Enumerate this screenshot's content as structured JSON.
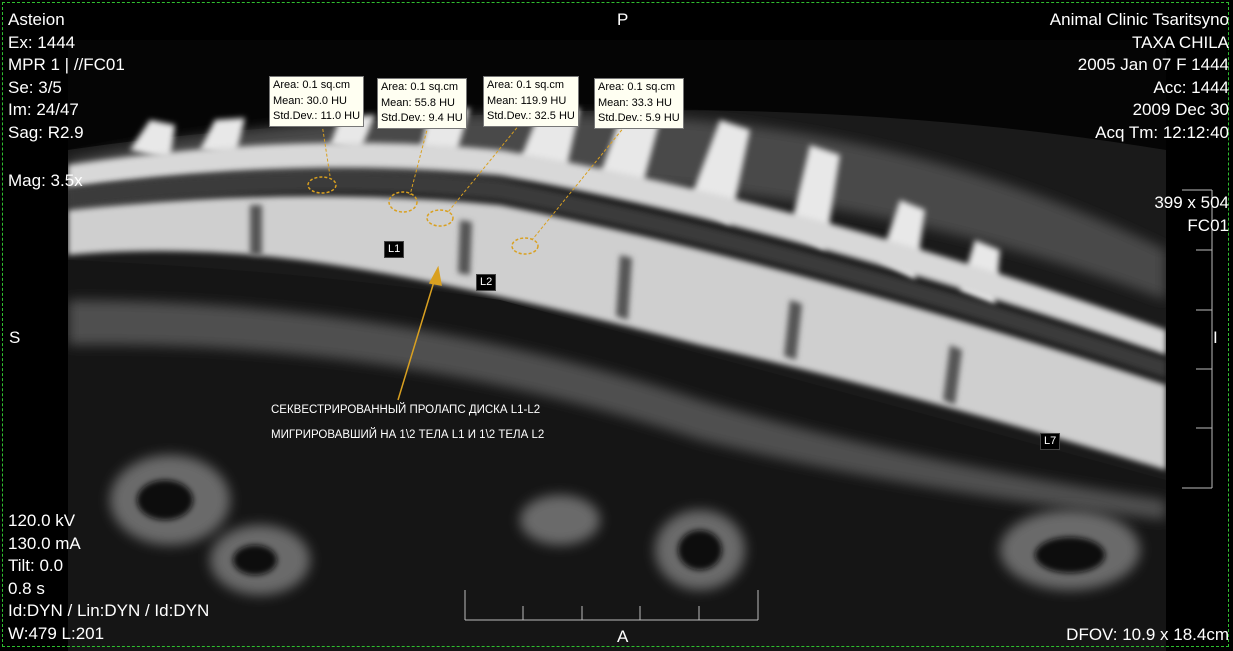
{
  "overlay": {
    "top_left": [
      "Asteion",
      "Ex: 1444",
      "MPR 1 | //FC01",
      "Se: 3/5",
      "Im: 24/47",
      "Sag: R2.9"
    ],
    "mag": "Mag: 3.5x",
    "top_center": "P",
    "top_right": [
      "Animal Clinic Tsaritsyno",
      "TAXA CHILA",
      "2005 Jan 07  F  1444",
      "Acc: 1444",
      "2009 Dec 30",
      "Acq Tm: 12:12:40"
    ],
    "matrix": [
      "399 x 504",
      "FC01"
    ],
    "left_orient": "S",
    "right_orient": "I",
    "bottom_left": [
      "120.0 kV",
      "130.0 mA",
      "Tilt: 0.0",
      "0.8 s",
      "Id:DYN / Lin:DYN / Id:DYN",
      "W:479  L:201"
    ],
    "bottom_center": "A",
    "bottom_right": "DFOV: 10.9 x 18.4cm"
  },
  "rois": [
    {
      "area": "Area: 0.1 sq.cm",
      "mean": "Mean: 30.0 HU",
      "std": "Std.Dev.: 11.0 HU"
    },
    {
      "area": "Area: 0.1 sq.cm",
      "mean": "Mean: 55.8 HU",
      "std": "Std.Dev.: 9.4 HU"
    },
    {
      "area": "Area: 0.1 sq.cm",
      "mean": "Mean: 119.9 HU",
      "std": "Std.Dev.: 32.5 HU"
    },
    {
      "area": "Area: 0.1 sq.cm",
      "mean": "Mean: 33.3 HU",
      "std": "Std.Dev.: 5.9 HU"
    }
  ],
  "vertebra_labels": {
    "l1": "L1",
    "l2": "L2",
    "l7": "L7"
  },
  "annotation": [
    "СЕКВЕСТРИРОВАННЫЙ ПРОЛАПС ДИСКА L1-L2",
    "МИГРИРОВАВШИЙ НА 1\\2 ТЕЛА L1 И 1\\2 ТЕЛА L2"
  ],
  "colors": {
    "annotation": "#d9a020",
    "border": "#2fbf2f",
    "overlay_text": "#ffffff"
  }
}
